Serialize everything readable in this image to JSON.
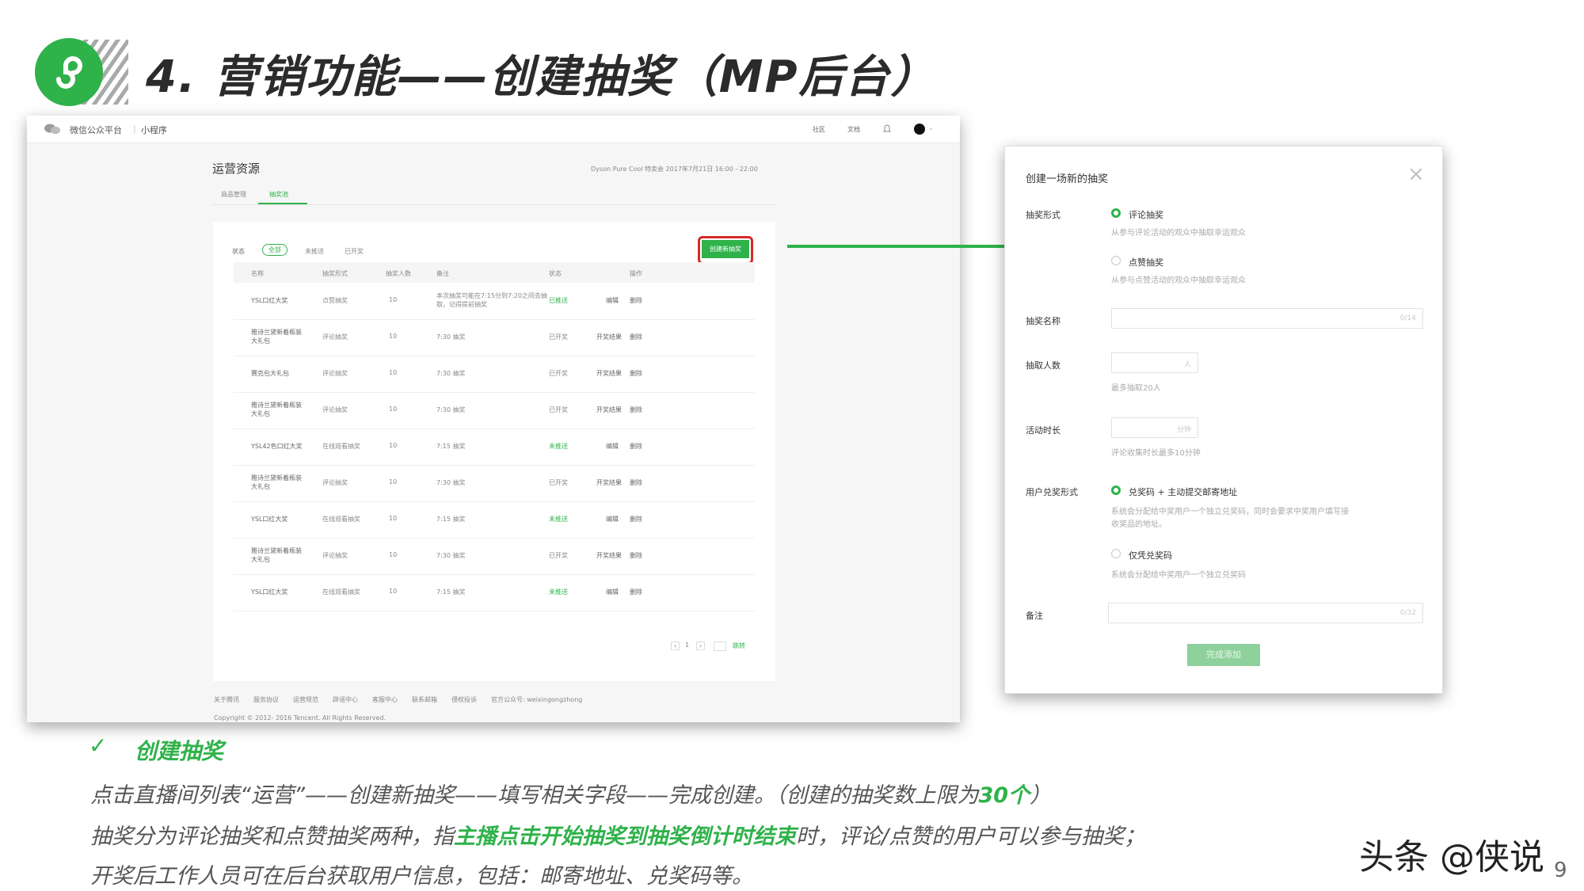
{
  "slide": {
    "title": "4. 营销功能——创建抽奖（MP后台）",
    "watermark": "头条 @侠说",
    "page_number": "9"
  },
  "admin": {
    "brand": "微信公众平台",
    "section": "小程序",
    "nav_community": "社区",
    "nav_docs": "文档",
    "page_title": "运营资源",
    "live_info": "Dyson Pure Cool 特卖会   2017年7月21日 16:00 - 22:00",
    "tabs": [
      "商品管理",
      "抽奖池"
    ],
    "filter_label": "状态",
    "filters": [
      "全部",
      "未推送",
      "已开奖"
    ],
    "create_button": "创建新抽奖",
    "columns": [
      "名称",
      "抽奖形式",
      "抽奖人数",
      "备注",
      "状态",
      "操作"
    ],
    "rows": [
      {
        "name": "YSL口红大奖",
        "type": "点赞抽奖",
        "count": "10",
        "note": "本次抽奖可能在7:15分到7:20之间去抽取，记得提前抽奖",
        "status": "已推送",
        "action1": "编辑",
        "action2": "删除"
      },
      {
        "name": "雅诗兰黛新着瓶装大礼包",
        "type": "评论抽奖",
        "count": "10",
        "note": "7:30 抽奖",
        "status": "已开奖",
        "action1": "开奖结果",
        "action2": "删除"
      },
      {
        "name": "赛克包大礼包",
        "type": "评论抽奖",
        "count": "10",
        "note": "7:30 抽奖",
        "status": "已开奖",
        "action1": "开奖结果",
        "action2": "删除"
      },
      {
        "name": "雅诗兰黛新着瓶装大礼包",
        "type": "评论抽奖",
        "count": "10",
        "note": "7:30 抽奖",
        "status": "已开奖",
        "action1": "开奖结果",
        "action2": "删除"
      },
      {
        "name": "YSL42色口红大奖",
        "type": "在线观看抽奖",
        "count": "10",
        "note": "7:15 抽奖",
        "status": "未推送",
        "action1": "编辑",
        "action2": "删除"
      },
      {
        "name": "雅诗兰黛新着瓶装大礼包",
        "type": "评论抽奖",
        "count": "10",
        "note": "7:30 抽奖",
        "status": "已开奖",
        "action1": "开奖结果",
        "action2": "删除"
      },
      {
        "name": "YSL口红大奖",
        "type": "在线观看抽奖",
        "count": "10",
        "note": "7:15 抽奖",
        "status": "未推送",
        "action1": "编辑",
        "action2": "删除"
      },
      {
        "name": "雅诗兰黛新着瓶装大礼包",
        "type": "评论抽奖",
        "count": "10",
        "note": "7:30 抽奖",
        "status": "已开奖",
        "action1": "开奖结果",
        "action2": "删除"
      },
      {
        "name": "YSL口红大奖",
        "type": "在线观看抽奖",
        "count": "10",
        "note": "7:15 抽奖",
        "status": "未推送",
        "action1": "编辑",
        "action2": "删除"
      }
    ],
    "pager_prev": "‹",
    "pager_page": "1",
    "pager_next": "›",
    "pager_jump": "跳转",
    "footer_links": [
      "关于腾讯",
      "服务协议",
      "运营规范",
      "辟谣中心",
      "客服中心",
      "联系邮箱",
      "侵权投诉",
      "官方公众号: weixingongzhong"
    ],
    "copyright": "Copyright © 2012- 2016 Tencent. All Rights Reserved."
  },
  "dialog": {
    "title": "创建一场新的抽奖",
    "close": "×",
    "lottery_type_label": "抽奖形式",
    "option_comment": "评论抽奖",
    "option_comment_hint": "从参与评论活动的观众中抽取幸运观众",
    "option_like": "点赞抽奖",
    "option_like_hint": "从参与点赞活动的观众中抽取幸运观众",
    "name_label": "抽奖名称",
    "name_counter": "0/14",
    "count_label": "抽取人数",
    "count_unit": "人",
    "count_hint": "最多抽取20人",
    "duration_label": "活动时长",
    "duration_unit": "分钟",
    "duration_hint": "评论收集时长最多10分钟",
    "redeem_label": "用户兑奖形式",
    "redeem_option1": "兑奖码 + 主动提交邮寄地址",
    "redeem_option1_hint_line1": "系统会分配给中奖用户一个独立兑奖码，同时会要求中奖用户填写接",
    "redeem_option1_hint_line2": "收奖品的地址。",
    "redeem_option2": "仅凭兑奖码",
    "redeem_option2_hint": "系统会分配给中奖用户一个独立兑奖码",
    "remark_label": "备注",
    "remark_counter": "0/32",
    "submit": "完成添加"
  },
  "notes": {
    "heading": "创建抽奖",
    "line1_pre": "点击直播间列表“运营”——创建新抽奖——填写相关字段——完成创建。（创建的抽奖数上限为",
    "line1_hl": "30个",
    "line1_post": "）",
    "line2_pre": "抽奖分为评论抽奖和点赞抽奖两种，指",
    "line2_hl": "主播点击开始抽奖到抽奖倒计时结束",
    "line2_post": "时，评论/点赞的用户可以参与抽奖；",
    "line3": "开奖后工作人员可在后台获取用户信息，包括：邮寄地址、兑奖码等。"
  },
  "colors": {
    "accent": "#2fb24a",
    "highlight_ring": "#d42a2a"
  }
}
